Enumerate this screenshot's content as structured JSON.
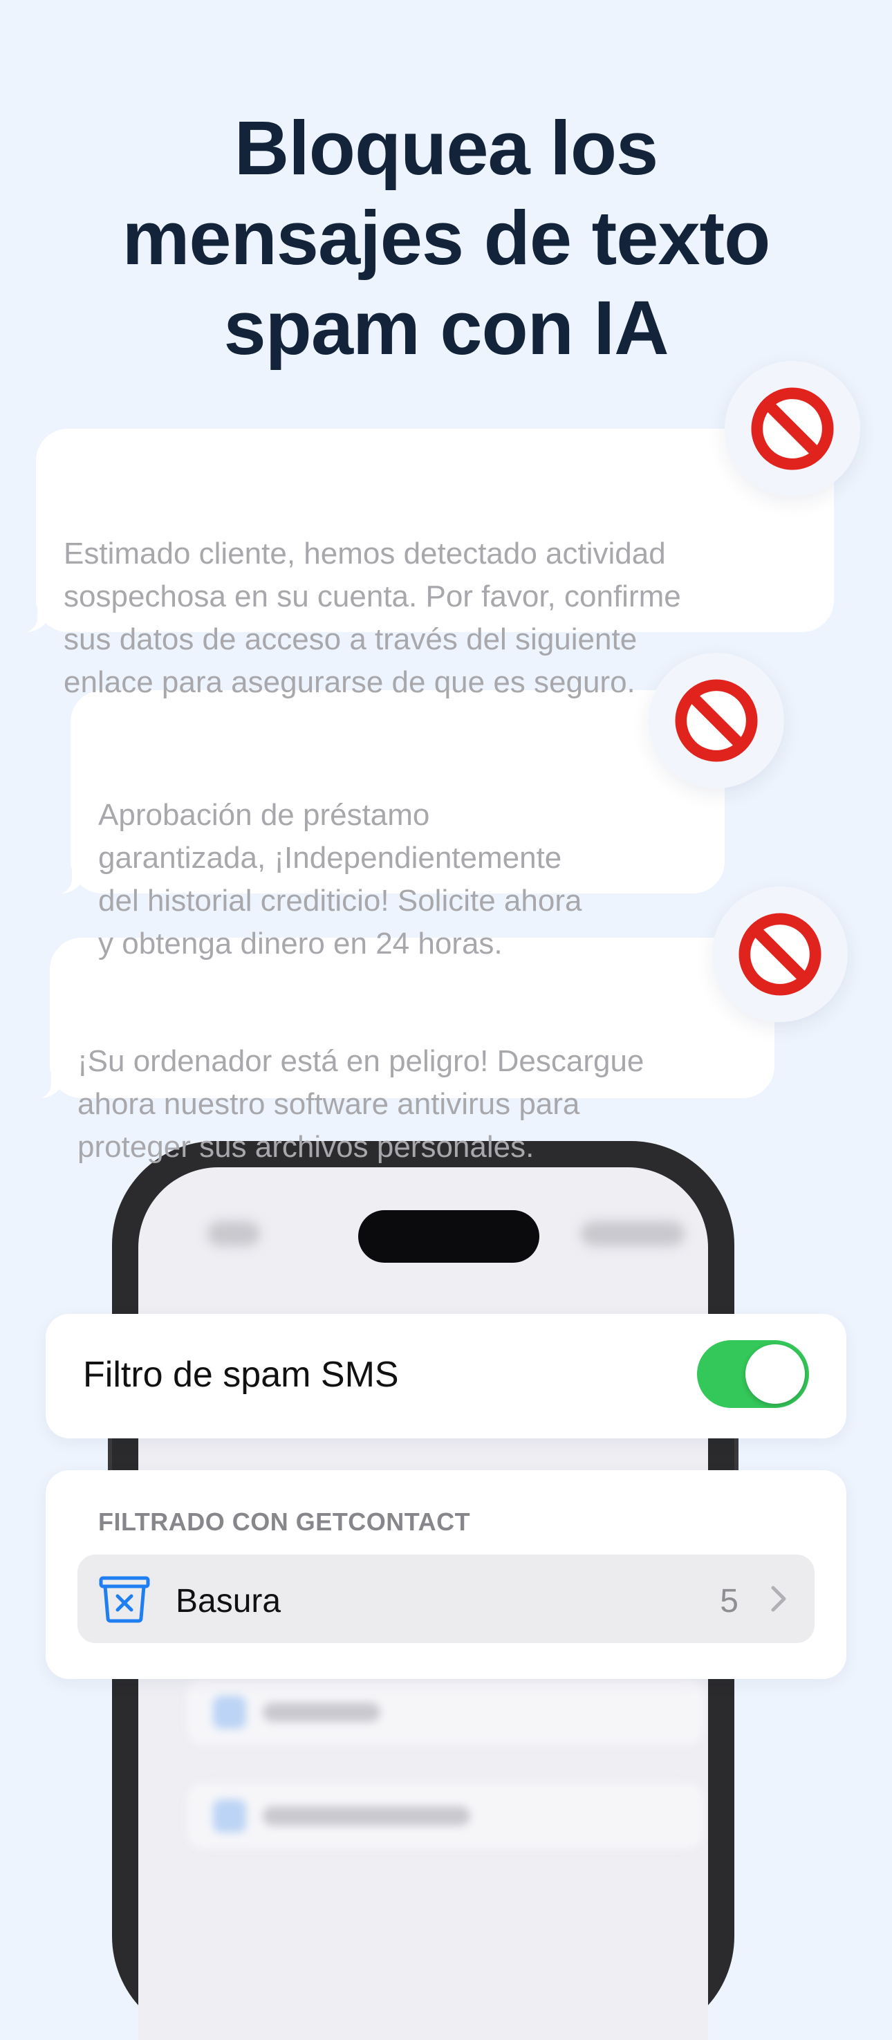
{
  "headline": "Bloquea los\nmensajes de texto\nspam con IA",
  "messages": [
    "Estimado cliente, hemos detectado actividad\nsospechosa en su cuenta. Por favor, confirme\nsus datos de acceso a través del siguiente\nenlace para asegurarse de que es seguro.",
    "Aprobación de préstamo\ngarantizada, ¡Independientemente\ndel historial crediticio! Solicite ahora\ny obtenga dinero en 24 horas.",
    "¡Su ordenador está en peligro! Descargue\nahora nuestro software antivirus para\nproteger sus archivos personales."
  ],
  "spam_filter": {
    "label": "Filtro de spam SMS",
    "enabled": true
  },
  "filtered_section": {
    "header": "FILTRADO CON GETCONTACT",
    "row_label": "Basura",
    "row_count": "5"
  },
  "colors": {
    "background": "#edf4fd",
    "headline": "#13233a",
    "toggle_on": "#34c759",
    "block_red": "#e0231d",
    "trash_icon": "#1f7ff2"
  },
  "icons": {
    "block": "no-entry-sign-icon",
    "trash": "trash-bin-icon",
    "chevron": "chevron-right-icon"
  }
}
